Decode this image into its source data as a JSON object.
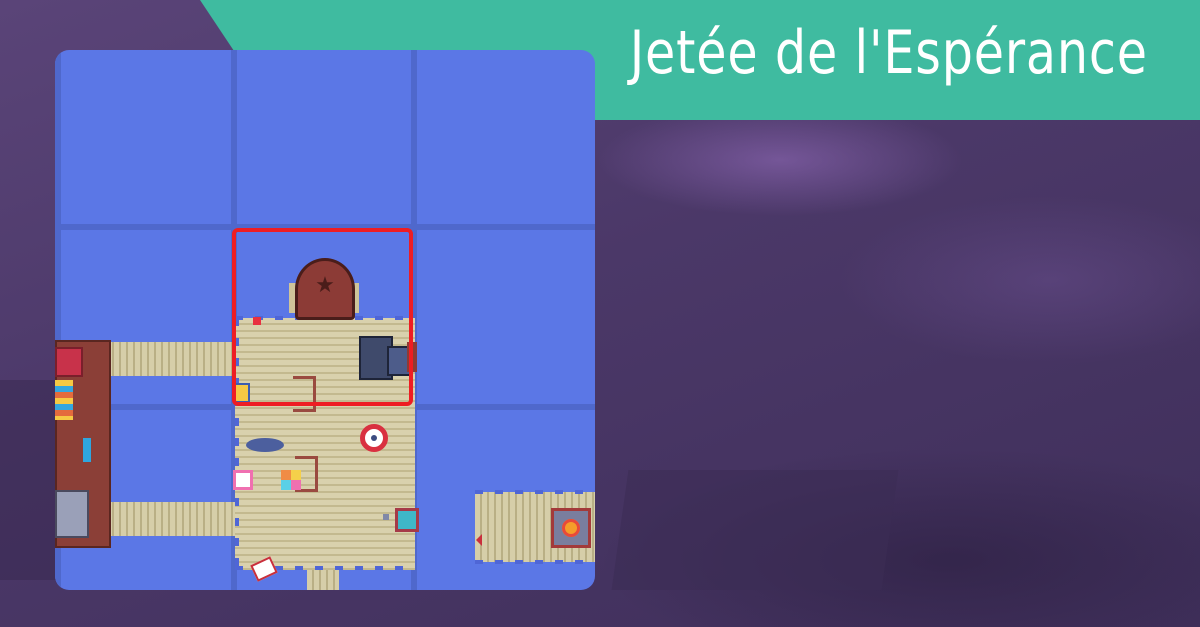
{
  "banner": {
    "title": "Jetée de l'Espérance",
    "color": "#3fbba0"
  },
  "map": {
    "water_color": "#5b77e6",
    "highlight_color": "#ee1d23",
    "icons": [
      "boiler-star-icon",
      "lifebuoy-icon",
      "candy-icon",
      "treasure-box-icon"
    ]
  }
}
